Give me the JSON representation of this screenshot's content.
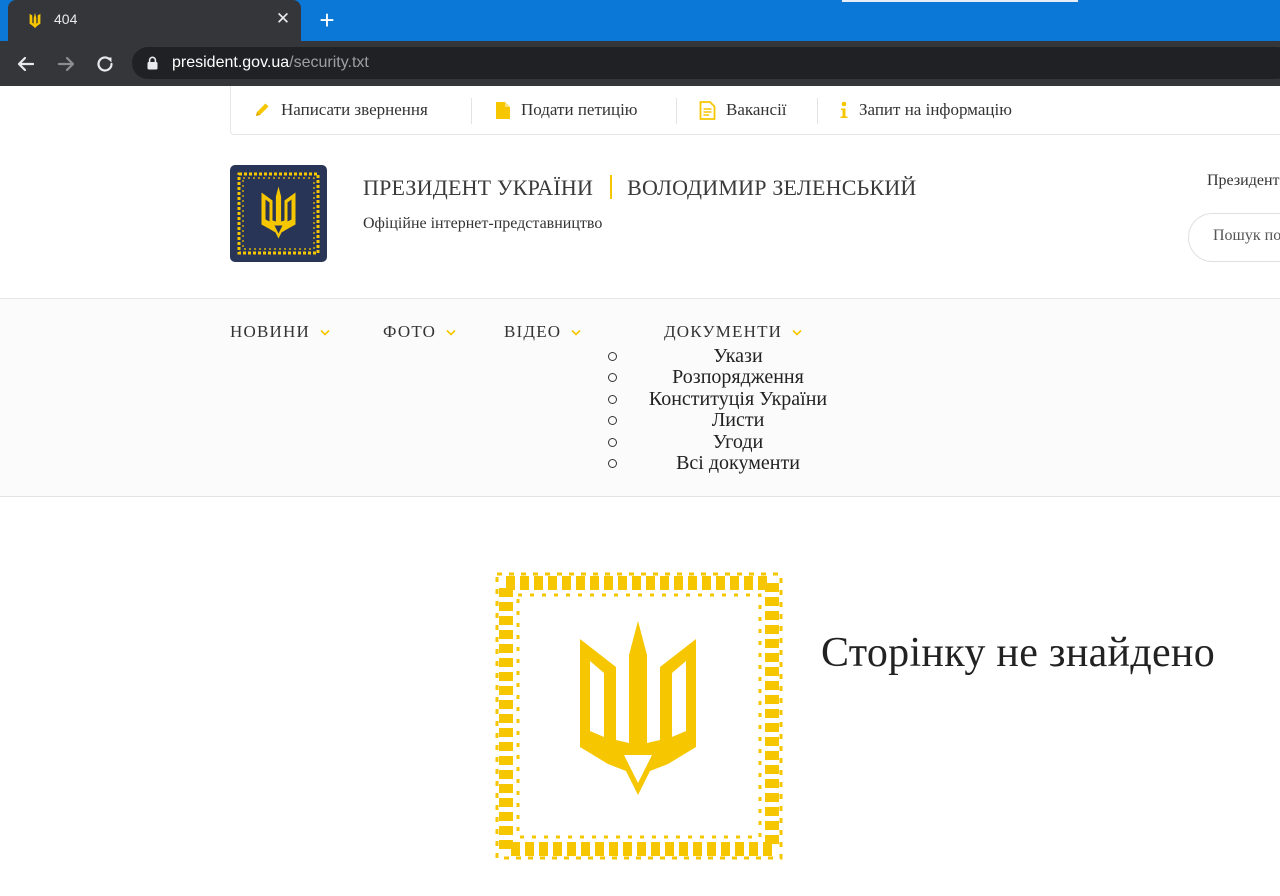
{
  "browser": {
    "tab": {
      "title": "404",
      "favicon": "trident-icon"
    },
    "url": {
      "domain": "president.gov.ua",
      "path": "/security.txt"
    },
    "colors": {
      "tabstrip": "#0b78d8",
      "toolbar": "#35363a",
      "omnibox": "#202124"
    }
  },
  "utility_bar": {
    "items": [
      {
        "label": "Написати звернення",
        "icon": "pencil-icon"
      },
      {
        "label": "Подати петицію",
        "icon": "document-icon"
      },
      {
        "label": "Вакансії",
        "icon": "list-document-icon"
      },
      {
        "label": "Запит на інформацію",
        "icon": "info-icon"
      }
    ]
  },
  "header": {
    "title_left": "ПРЕЗИДЕНТ УКРАЇНИ",
    "title_right": "ВОЛОДИМИР ЗЕЛЕНСЬКИЙ",
    "subtitle": "Офіційне інтернет-представництво",
    "president_link": "Президент",
    "search_placeholder": "Пошук по сайту"
  },
  "nav": {
    "items": [
      {
        "label": "НОВИНИ"
      },
      {
        "label": "ФОТО"
      },
      {
        "label": "ВІДЕО"
      },
      {
        "label": "ДОКУМЕНТИ"
      }
    ],
    "documents_submenu": [
      "Укази",
      "Розпорядження",
      "Конституція України",
      "Листи",
      "Угоди",
      "Всі документи"
    ]
  },
  "content": {
    "not_found_title": "Сторінку не знайдено"
  },
  "colors": {
    "accent": "#f6c700",
    "emblem_bg": "#283557",
    "text": "#333333"
  }
}
